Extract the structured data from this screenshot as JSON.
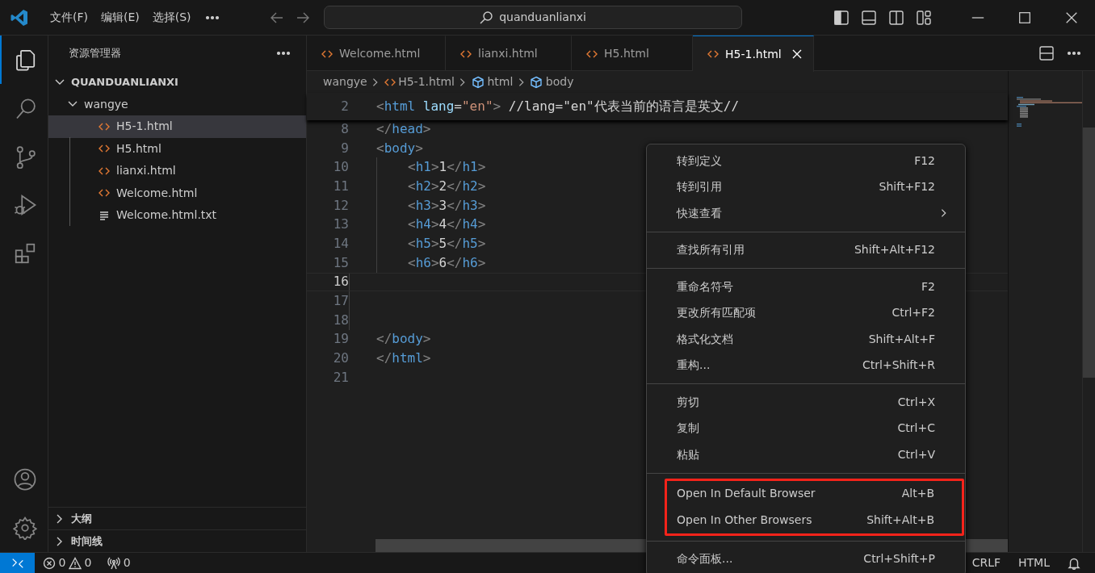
{
  "title_bar": {
    "menus": [
      "文件(F)",
      "编辑(E)",
      "选择(S)"
    ],
    "search": "quanduanlianxi"
  },
  "activity_bar": {
    "items": [
      {
        "kind": "explorer",
        "selected": true
      },
      {
        "kind": "search",
        "selected": false
      },
      {
        "kind": "source-control",
        "selected": false
      },
      {
        "kind": "run-debug",
        "selected": false
      },
      {
        "kind": "extensions",
        "selected": false
      }
    ],
    "bottom": [
      {
        "kind": "account"
      },
      {
        "kind": "settings"
      }
    ]
  },
  "sidebar": {
    "title": "资源管理器",
    "tree": [
      {
        "label": "QUANDUANLIANXI",
        "kind": "root",
        "expanded": true,
        "selected": false,
        "children": [
          {
            "label": "wangye",
            "kind": "folder",
            "expanded": true,
            "selected": false,
            "children": [
              {
                "label": "H5-1.html",
                "kind": "html",
                "selected": true
              },
              {
                "label": "H5.html",
                "kind": "html",
                "selected": false
              },
              {
                "label": "lianxi.html",
                "kind": "html",
                "selected": false
              },
              {
                "label": "Welcome.html",
                "kind": "html",
                "selected": false
              },
              {
                "label": "Welcome.html.txt",
                "kind": "text",
                "selected": false
              }
            ]
          }
        ]
      }
    ],
    "sections": [
      {
        "label": "大纲",
        "expanded": false
      },
      {
        "label": "时间线",
        "expanded": false
      }
    ]
  },
  "tabs": [
    {
      "label": "Welcome.html",
      "selected": false
    },
    {
      "label": "lianxi.html",
      "selected": false
    },
    {
      "label": "H5.html",
      "selected": false
    },
    {
      "label": "H5-1.html",
      "selected": true
    }
  ],
  "breadcrumbs": [
    {
      "label": "wangye",
      "kind": "folder"
    },
    {
      "label": "H5-1.html",
      "kind": "html"
    },
    {
      "label": "html",
      "kind": "symbol"
    },
    {
      "label": "body",
      "kind": "symbol"
    }
  ],
  "sticky_line": {
    "number": "2",
    "tokens": [
      {
        "kind": "p",
        "text": "<"
      },
      {
        "kind": "tag",
        "text": "html"
      },
      {
        "kind": "attr",
        "text": " lang"
      },
      {
        "kind": "text",
        "text": "="
      },
      {
        "kind": "str",
        "text": "\"en\""
      },
      {
        "kind": "p",
        "text": ">"
      },
      {
        "kind": "text",
        "text": " //lang=\"en\"代表当前的语言是英文//"
      }
    ]
  },
  "lines": [
    {
      "number": "8",
      "current": false,
      "tokens": [
        {
          "kind": "p",
          "text": "</"
        },
        {
          "kind": "tag",
          "text": "head"
        },
        {
          "kind": "p",
          "text": ">"
        }
      ]
    },
    {
      "number": "9",
      "current": false,
      "tokens": [
        {
          "kind": "p",
          "text": "<"
        },
        {
          "kind": "tag",
          "text": "body"
        },
        {
          "kind": "p",
          "text": ">"
        }
      ],
      "children": [
        {
          "number": "10",
          "current": false,
          "tokens": [
            {
              "kind": "p",
              "text": "<"
            },
            {
              "kind": "tag",
              "text": "h1"
            },
            {
              "kind": "p",
              "text": ">"
            },
            {
              "kind": "text",
              "text": "1"
            },
            {
              "kind": "p",
              "text": "</"
            },
            {
              "kind": "tag",
              "text": "h1"
            },
            {
              "kind": "p",
              "text": ">"
            }
          ]
        },
        {
          "number": "11",
          "current": false,
          "tokens": [
            {
              "kind": "p",
              "text": "<"
            },
            {
              "kind": "tag",
              "text": "h2"
            },
            {
              "kind": "p",
              "text": ">"
            },
            {
              "kind": "text",
              "text": "2"
            },
            {
              "kind": "p",
              "text": "</"
            },
            {
              "kind": "tag",
              "text": "h2"
            },
            {
              "kind": "p",
              "text": ">"
            }
          ]
        },
        {
          "number": "12",
          "current": false,
          "tokens": [
            {
              "kind": "p",
              "text": "<"
            },
            {
              "kind": "tag",
              "text": "h3"
            },
            {
              "kind": "p",
              "text": ">"
            },
            {
              "kind": "text",
              "text": "3"
            },
            {
              "kind": "p",
              "text": "</"
            },
            {
              "kind": "tag",
              "text": "h3"
            },
            {
              "kind": "p",
              "text": ">"
            }
          ]
        },
        {
          "number": "13",
          "current": false,
          "tokens": [
            {
              "kind": "p",
              "text": "<"
            },
            {
              "kind": "tag",
              "text": "h4"
            },
            {
              "kind": "p",
              "text": ">"
            },
            {
              "kind": "text",
              "text": "4"
            },
            {
              "kind": "p",
              "text": "</"
            },
            {
              "kind": "tag",
              "text": "h4"
            },
            {
              "kind": "p",
              "text": ">"
            }
          ]
        },
        {
          "number": "14",
          "current": false,
          "tokens": [
            {
              "kind": "p",
              "text": "<"
            },
            {
              "kind": "tag",
              "text": "h5"
            },
            {
              "kind": "p",
              "text": ">"
            },
            {
              "kind": "text",
              "text": "5"
            },
            {
              "kind": "p",
              "text": "</"
            },
            {
              "kind": "tag",
              "text": "h5"
            },
            {
              "kind": "p",
              "text": ">"
            }
          ]
        },
        {
          "number": "15",
          "current": false,
          "tokens": [
            {
              "kind": "p",
              "text": "<"
            },
            {
              "kind": "tag",
              "text": "h6"
            },
            {
              "kind": "p",
              "text": ">"
            },
            {
              "kind": "text",
              "text": "6"
            },
            {
              "kind": "p",
              "text": "</"
            },
            {
              "kind": "tag",
              "text": "h6"
            },
            {
              "kind": "p",
              "text": ">"
            }
          ]
        },
        {
          "number": "16",
          "current": true
        },
        {
          "number": "17",
          "current": false
        },
        {
          "number": "18",
          "current": false
        }
      ]
    },
    {
      "number": "19",
      "current": false,
      "tokens": [
        {
          "kind": "p",
          "text": "</"
        },
        {
          "kind": "tag",
          "text": "body"
        },
        {
          "kind": "p",
          "text": ">"
        }
      ]
    },
    {
      "number": "20",
      "current": false,
      "tokens": [
        {
          "kind": "p",
          "text": "</"
        },
        {
          "kind": "tag",
          "text": "html"
        },
        {
          "kind": "p",
          "text": ">"
        }
      ]
    },
    {
      "number": "21",
      "current": false
    }
  ],
  "context_menu": {
    "groups": [
      {
        "highlighted": false,
        "items": [
          {
            "label": "转到定义",
            "shortcut": "F12",
            "submenu": false
          },
          {
            "label": "转到引用",
            "shortcut": "Shift+F12",
            "submenu": false
          },
          {
            "label": "快速查看",
            "submenu": true
          }
        ]
      },
      {
        "highlighted": false,
        "items": [
          {
            "label": "查找所有引用",
            "shortcut": "Shift+Alt+F12",
            "submenu": false
          }
        ]
      },
      {
        "highlighted": false,
        "items": [
          {
            "label": "重命名符号",
            "shortcut": "F2",
            "submenu": false
          },
          {
            "label": "更改所有匹配项",
            "shortcut": "Ctrl+F2",
            "submenu": false
          },
          {
            "label": "格式化文档",
            "shortcut": "Shift+Alt+F",
            "submenu": false
          },
          {
            "label": "重构...",
            "shortcut": "Ctrl+Shift+R",
            "submenu": false
          }
        ]
      },
      {
        "highlighted": false,
        "items": [
          {
            "label": "剪切",
            "shortcut": "Ctrl+X",
            "submenu": false
          },
          {
            "label": "复制",
            "shortcut": "Ctrl+C",
            "submenu": false
          },
          {
            "label": "粘贴",
            "shortcut": "Ctrl+V",
            "submenu": false
          }
        ]
      },
      {
        "highlighted": true,
        "items": [
          {
            "label": "Open In Default Browser",
            "shortcut": "Alt+B",
            "submenu": false
          },
          {
            "label": "Open In Other Browsers",
            "shortcut": "Shift+Alt+B",
            "submenu": false
          }
        ]
      },
      {
        "highlighted": false,
        "items": [
          {
            "label": "命令面板...",
            "shortcut": "Ctrl+Shift+P",
            "submenu": false
          }
        ]
      }
    ]
  },
  "status_bar": {
    "errors": "0",
    "warnings": "0",
    "ports": "0",
    "eol": "CRLF",
    "language": "HTML"
  }
}
